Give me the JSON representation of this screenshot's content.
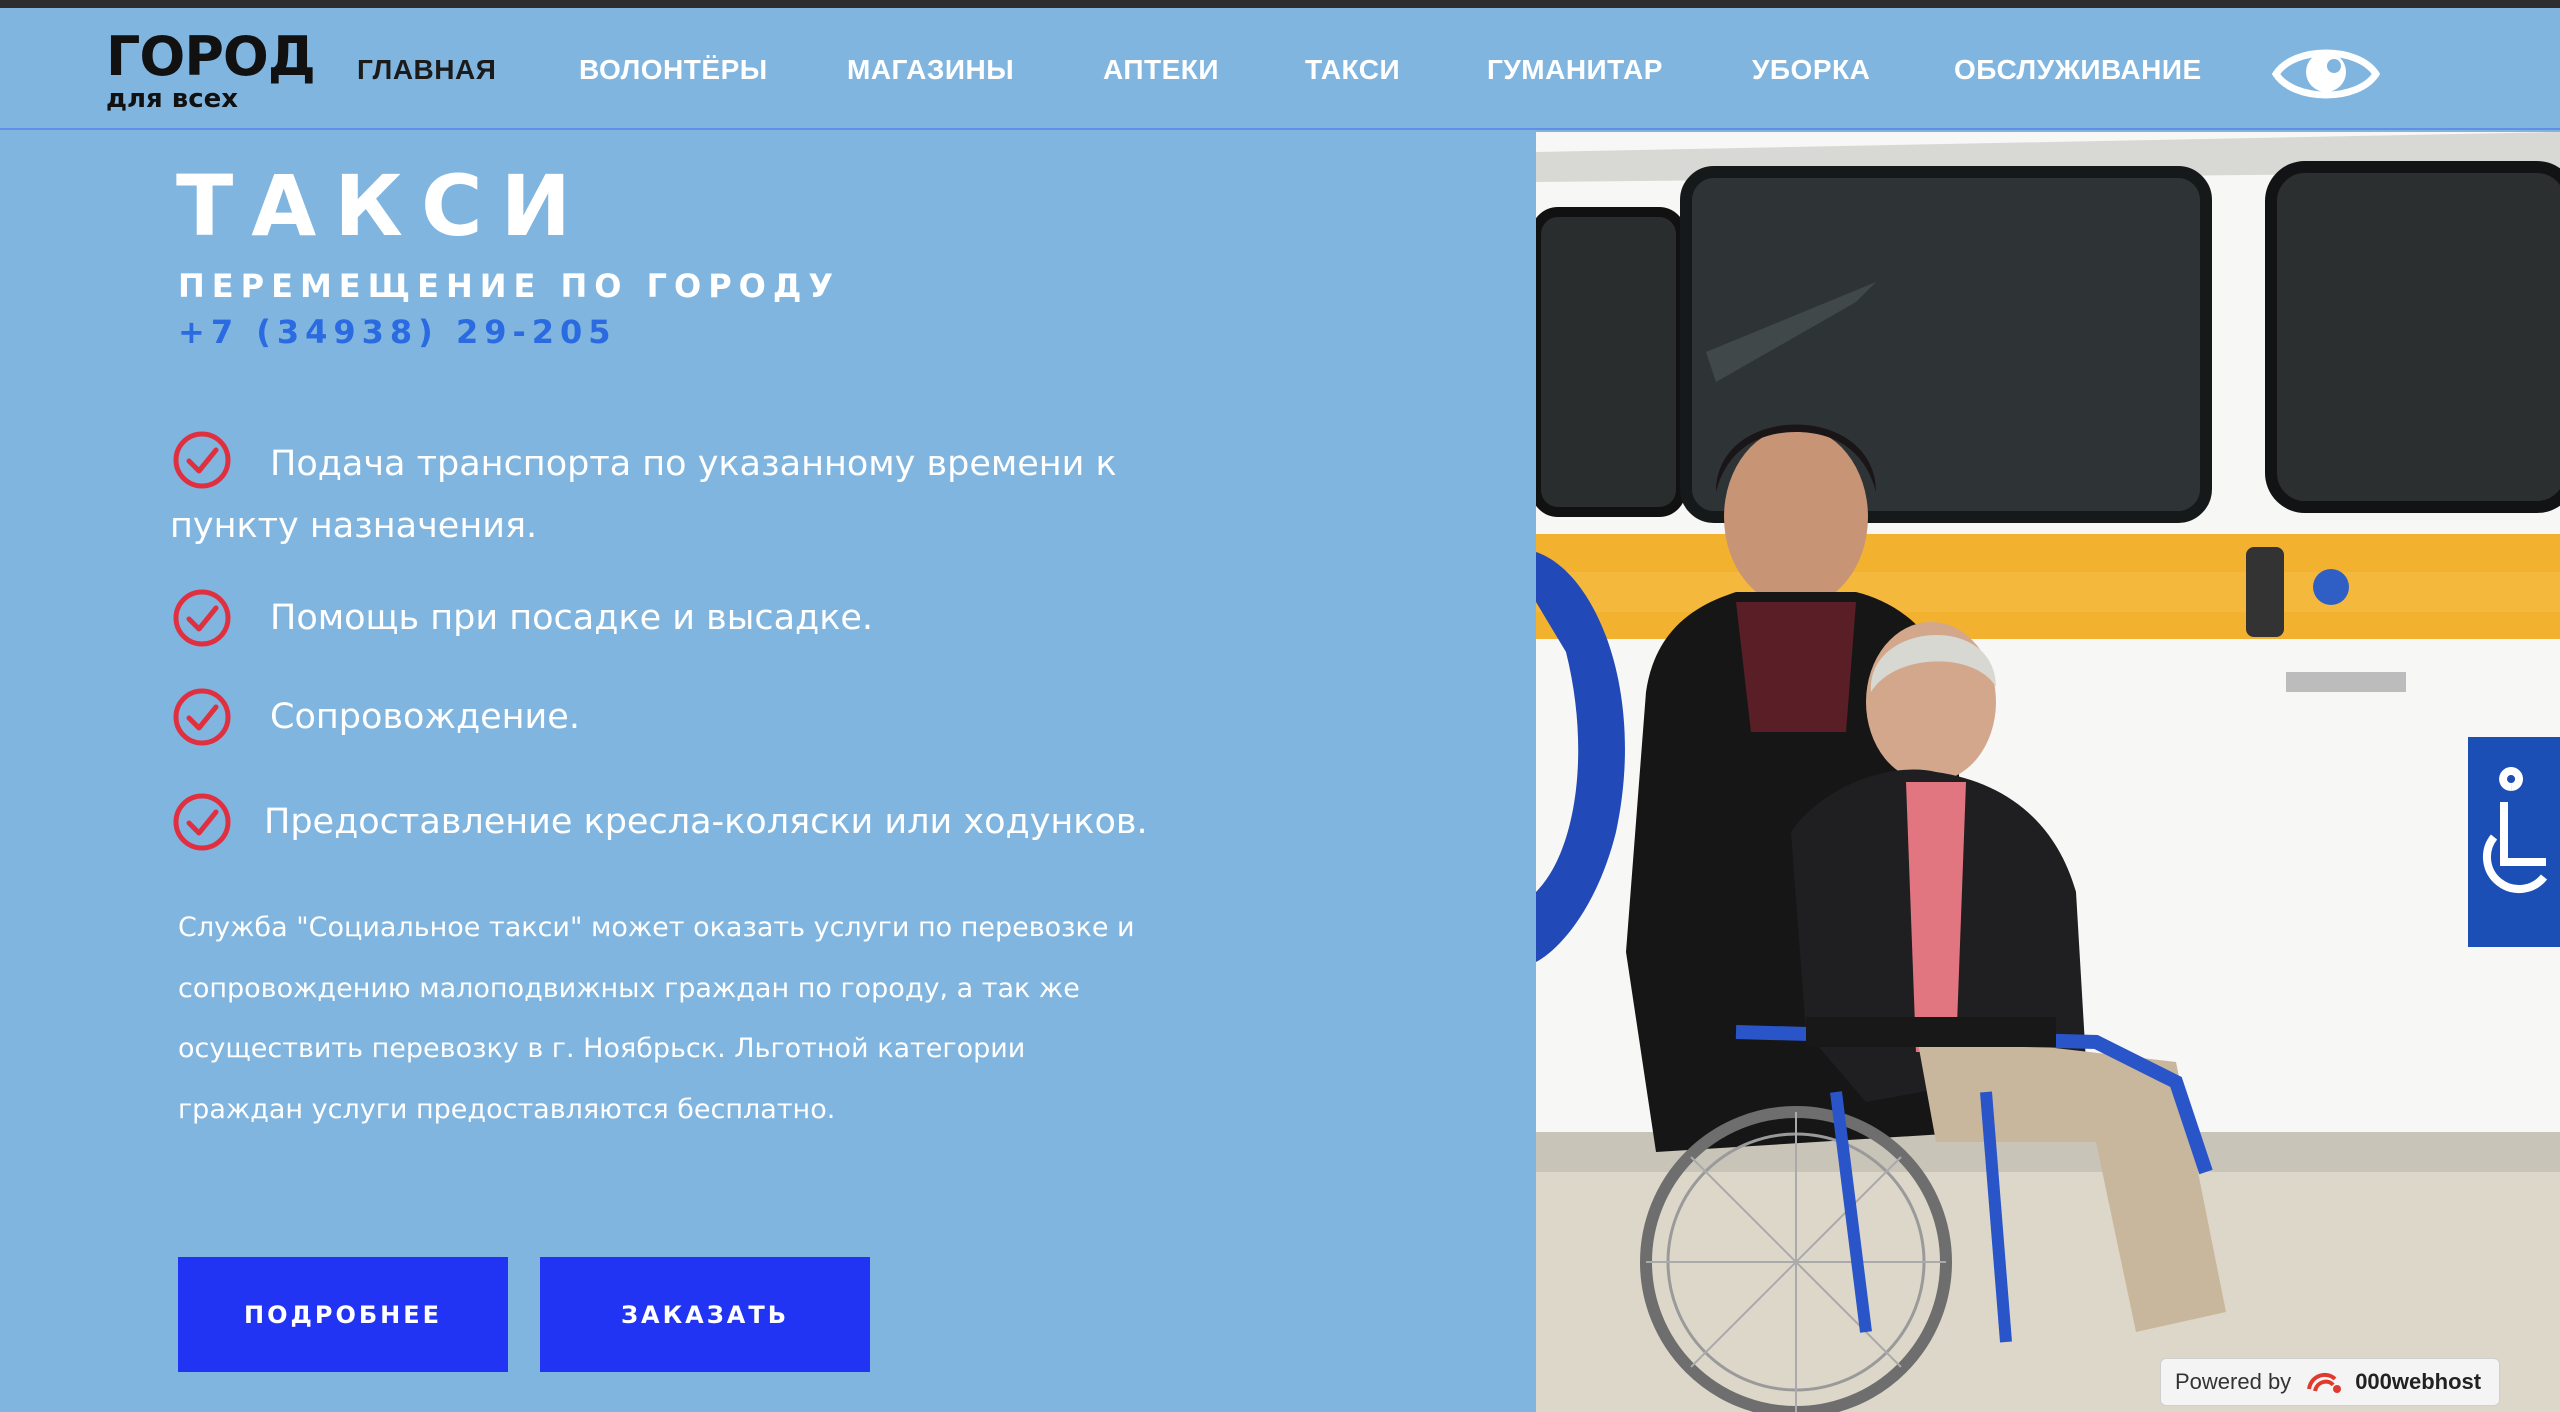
{
  "brand": {
    "logo_main": "ГОРОД",
    "logo_sub": "для всех"
  },
  "nav": {
    "items": [
      {
        "label": "ГЛАВНАЯ",
        "active": true
      },
      {
        "label": "ВОЛОНТЁРЫ"
      },
      {
        "label": "МАГАЗИНЫ"
      },
      {
        "label": "АПТЕКИ"
      },
      {
        "label": "ТАКСИ"
      },
      {
        "label": "ГУМАНИТАР"
      },
      {
        "label": "УБОРКА"
      },
      {
        "label": "ОБСЛУЖИВАНИЕ"
      }
    ],
    "accessibility_icon": "eye-icon"
  },
  "hero": {
    "title": "ТАКСИ",
    "subtitle": "ПЕРЕМЕЩЕНИЕ ПО ГОРОДУ",
    "phone": "+7 (34938) 29-205",
    "features": [
      "Подача транспорта по указанному времени к пункту назначения.",
      "Помощь при посадке и высадке.",
      "Сопровождение.",
      "Предоставление кресла-коляски или ходунков."
    ],
    "description": "Служба \"Социальное такси\" может оказать услуги по перевозке и сопровождению малоподвижных граждан по городу, а так же осуществить перевозку в г. Ноябрьск. Льготной категории граждан услуги предоставляются бесплатно.",
    "buttons": {
      "more": "ПОДРОБНЕЕ",
      "order": "ЗАКАЗАТЬ"
    }
  },
  "footer_badge": {
    "prefix": "Powered by",
    "brand": "000webhost"
  },
  "colors": {
    "background": "#80b5e0",
    "button": "#2234f3",
    "phone": "#2a6be2",
    "check": "#e0303f",
    "nav_active": "#1b1b1b"
  }
}
